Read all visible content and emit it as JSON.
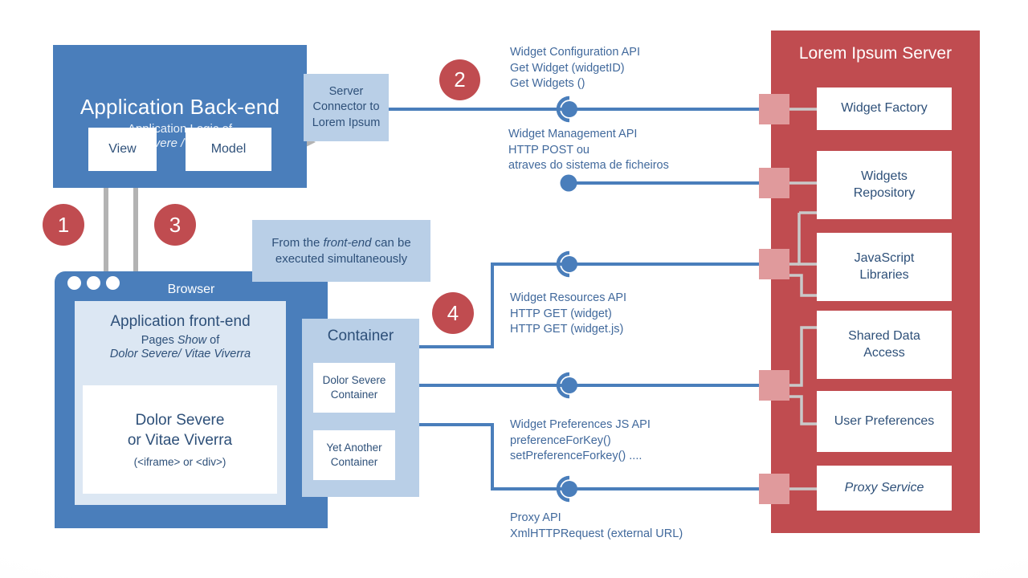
{
  "colors": {
    "blue_panel": "#4a7ebb",
    "light_blue_panel": "#b9cfe7",
    "pale_blue_panel": "#dce7f3",
    "red_panel": "#c04c50",
    "pink_port": "#e09a9c",
    "wire_blue": "#4a7ebb",
    "arrow_gray": "#b3b3b3",
    "text_blue": "#2e5079"
  },
  "backend": {
    "title": "Application Back-end",
    "subtitle_line1": "Application Logic of",
    "subtitle_line2": "Dolor Severe /Vitae Viverra",
    "view_label": "View",
    "model_label": "Model"
  },
  "server_connector": {
    "line1": "Server",
    "line2": "Connector to",
    "line3": "Lorem Ipsum"
  },
  "browser": {
    "label": "Browser",
    "frontend": {
      "title": "Application front-end",
      "subtitle_line1_pre": "Pages ",
      "subtitle_line1_em": "Show",
      "subtitle_line1_post": " of",
      "subtitle_line2": "Dolor Severe/ Vitae Viverra",
      "iframe_line1": "Dolor Severe",
      "iframe_line2": "or Vitae Viverra",
      "iframe_line3": "(<iframe> or <div>)"
    }
  },
  "container": {
    "title": "Container",
    "boxes": [
      {
        "line1": "Dolor Severe",
        "line2": "Container"
      },
      {
        "line1": "Yet Another",
        "line2": "Container"
      }
    ]
  },
  "note": {
    "pre": "From the ",
    "em": "front-end",
    "post": " can be executed simultaneously"
  },
  "server_panel": {
    "title": "Lorem Ipsum Server",
    "services": [
      {
        "name": "Widget Factory",
        "italic": false
      },
      {
        "name": "Widgets\nRepository",
        "italic": false
      },
      {
        "name": "JavaScript\nLibraries",
        "italic": false
      },
      {
        "name": "Shared Data\nAccess",
        "italic": false
      },
      {
        "name": "User Preferences",
        "italic": false
      },
      {
        "name": "Proxy Service",
        "italic": true
      }
    ]
  },
  "api_labels": [
    {
      "id": "widget-configuration-api",
      "text": "Widget Configuration API\nGet Widget (widgetID)\nGet Widgets ()"
    },
    {
      "id": "widget-management-api",
      "text": "Widget Management API\nHTTP POST ou\natraves do sistema de ficheiros"
    },
    {
      "id": "widget-resources-api",
      "text": "Widget Resources API\nHTTP GET (widget)\nHTTP GET (widget.js)"
    },
    {
      "id": "widget-preferences-js-api",
      "text": "Widget Preferences JS API\npreferenceForKey()\nsetPreferenceForkey() ...."
    },
    {
      "id": "proxy-api",
      "text": "Proxy API\nXmlHTTPRequest (external URL)"
    }
  ],
  "step_numbers": {
    "one": "1",
    "two": "2",
    "three": "3",
    "four": "4"
  }
}
